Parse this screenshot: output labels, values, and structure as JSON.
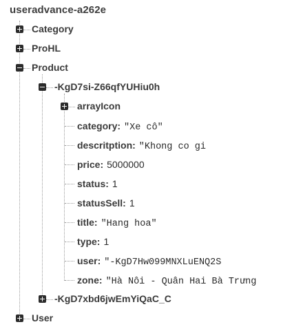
{
  "root": {
    "label": "useradvance-a262e"
  },
  "nodes": {
    "category": {
      "label": "Category"
    },
    "prohl": {
      "label": "ProHL"
    },
    "product": {
      "label": "Product"
    },
    "user": {
      "label": "User"
    }
  },
  "product_children": {
    "first": {
      "label": "-KgD7si-Z66qfYUHiu0h"
    },
    "second": {
      "label": "-KgD7xbd6jwEmYiQaC_C"
    }
  },
  "item": {
    "array_icon": {
      "label": "arrayIcon"
    },
    "fields": [
      {
        "key": "category:",
        "value": "\"Xe cô\""
      },
      {
        "key": "descritption:",
        "value": "\"Khong co gi"
      },
      {
        "key": "price:",
        "value": "5000000"
      },
      {
        "key": "status:",
        "value": "1"
      },
      {
        "key": "statusSell:",
        "value": "1"
      },
      {
        "key": "title:",
        "value": "\"Hang hoa\""
      },
      {
        "key": "type:",
        "value": "1"
      },
      {
        "key": "user:",
        "value": "\"-KgD7Hw099MNXLuENQ2S"
      },
      {
        "key": "zone:",
        "value": "\"Hà Nôi - Quân Hai Bà Trưng"
      }
    ]
  }
}
